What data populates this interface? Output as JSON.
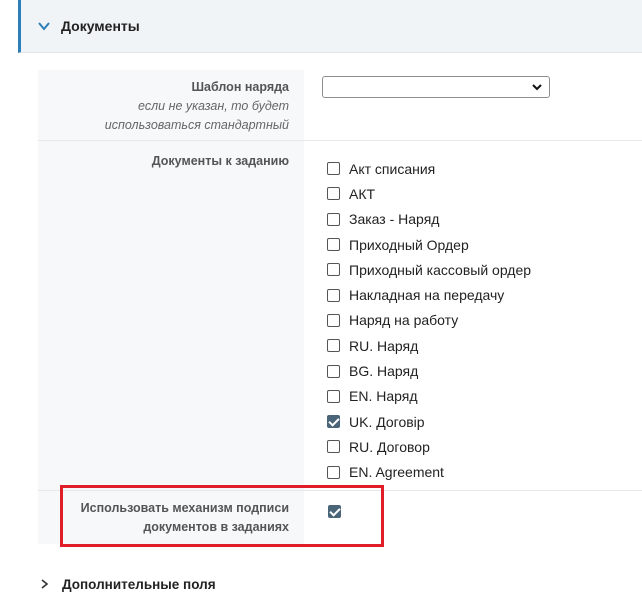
{
  "section": {
    "title": "Документы",
    "icon": "chevron-down-icon"
  },
  "template_field": {
    "label": "Шаблон наряда",
    "hint_line1": "если не указан, то будет",
    "hint_line2": "использоваться стандартный",
    "selected_value": ""
  },
  "documents_field": {
    "label": "Документы к заданию",
    "items": [
      {
        "label": "Акт списания",
        "checked": false
      },
      {
        "label": "АКТ",
        "checked": false
      },
      {
        "label": "Заказ - Наряд",
        "checked": false
      },
      {
        "label": "Приходный Ордер",
        "checked": false
      },
      {
        "label": "Приходный кассовый ордер",
        "checked": false
      },
      {
        "label": "Накладная на передачу",
        "checked": false
      },
      {
        "label": "Наряд на работу",
        "checked": false
      },
      {
        "label": "RU. Наряд",
        "checked": false
      },
      {
        "label": "BG. Наряд",
        "checked": false
      },
      {
        "label": "EN. Наряд",
        "checked": false
      },
      {
        "label": "UK. Договір",
        "checked": true
      },
      {
        "label": "RU. Договор",
        "checked": false
      },
      {
        "label": "EN. Agreement",
        "checked": false
      }
    ]
  },
  "sign_field": {
    "label_line1": "Использовать механизм подписи",
    "label_line2": "документов в заданиях",
    "checked": true
  },
  "footer_section": {
    "title": "Дополнительные поля",
    "icon": "chevron-right-icon"
  },
  "colors": {
    "accent": "#2c7fb8",
    "highlight": "#e01e2a",
    "checkbox_checked": "#4a6478"
  }
}
